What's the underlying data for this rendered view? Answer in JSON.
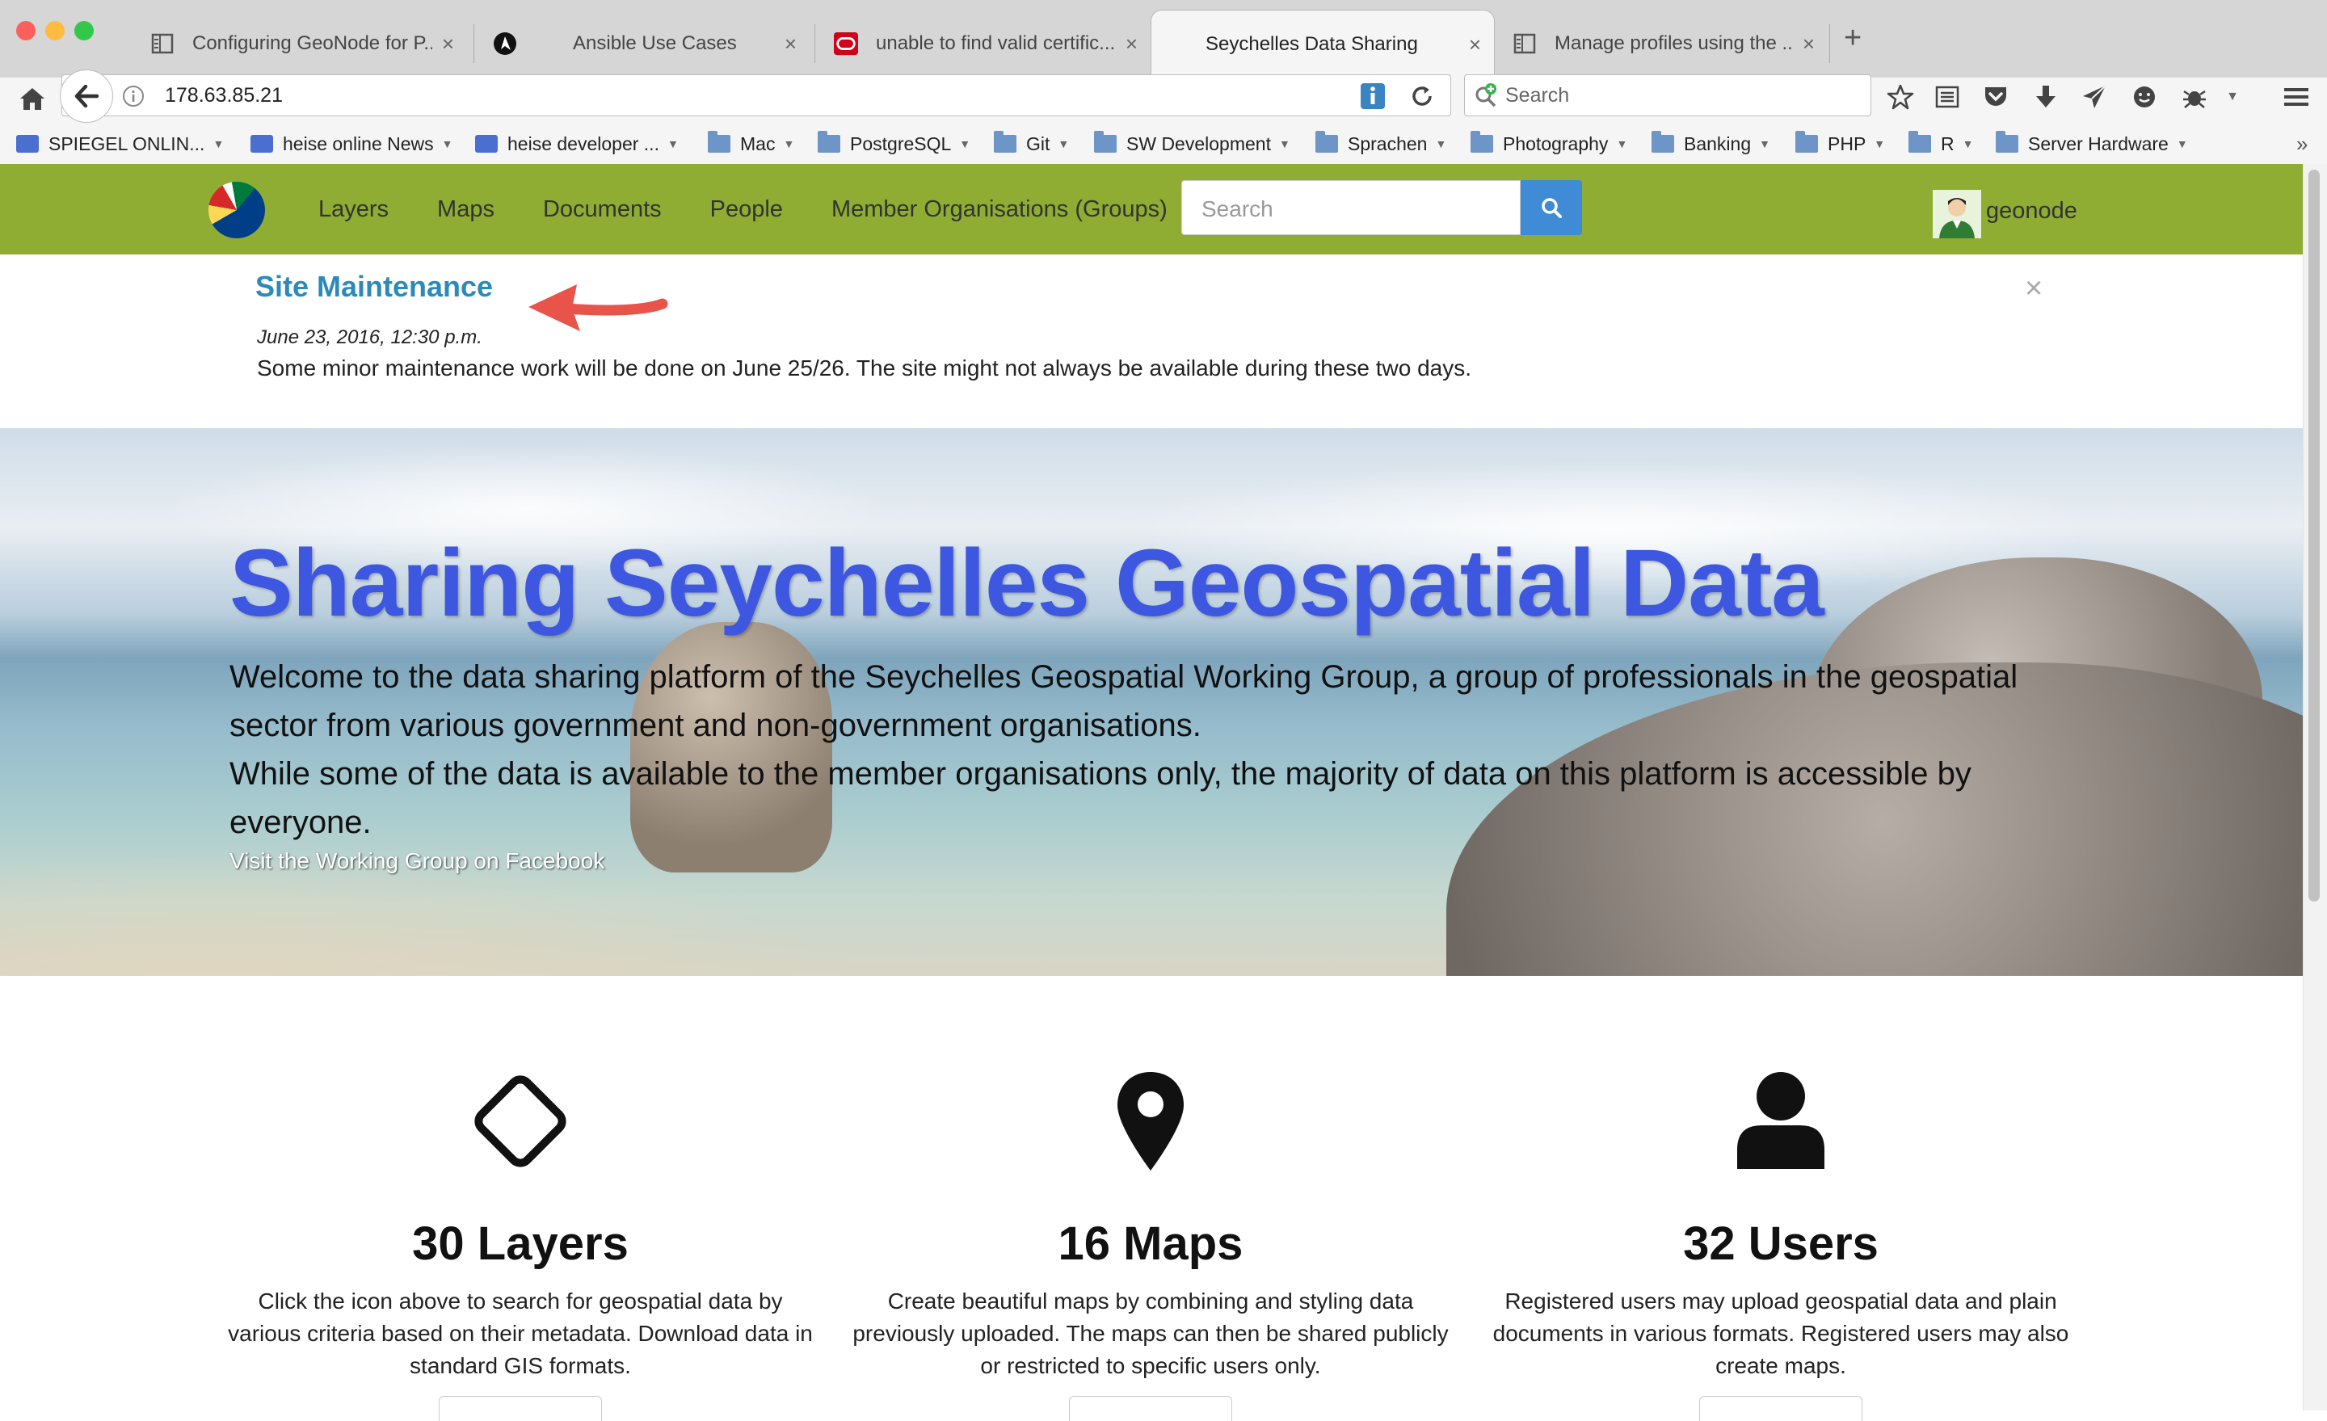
{
  "browser": {
    "tabs": [
      {
        "title": "Configuring GeoNode for P...",
        "icon": "reader-icon"
      },
      {
        "title": "Ansible Use Cases",
        "icon": "ansible-icon"
      },
      {
        "title": "unable to find valid certific...",
        "icon": "oracle-icon"
      },
      {
        "title": "Seychelles Data Sharing",
        "icon": "none",
        "active": true
      },
      {
        "title": "Manage profiles using the ...",
        "icon": "reader-icon"
      }
    ],
    "url": "178.63.85.21",
    "search_placeholder": "Search",
    "bookmarks": [
      {
        "label": "SPIEGEL ONLIN...",
        "type": "feed"
      },
      {
        "label": "heise online News",
        "type": "feed"
      },
      {
        "label": "heise developer ...",
        "type": "feed"
      },
      {
        "label": "Mac",
        "type": "folder"
      },
      {
        "label": "PostgreSQL",
        "type": "folder"
      },
      {
        "label": "Git",
        "type": "folder"
      },
      {
        "label": "SW Development",
        "type": "folder"
      },
      {
        "label": "Sprachen",
        "type": "folder"
      },
      {
        "label": "Photography",
        "type": "folder"
      },
      {
        "label": "Banking",
        "type": "folder"
      },
      {
        "label": "PHP",
        "type": "folder"
      },
      {
        "label": "R",
        "type": "folder"
      },
      {
        "label": "Server Hardware",
        "type": "folder"
      }
    ]
  },
  "site": {
    "nav": [
      "Layers",
      "Maps",
      "Documents",
      "People",
      "Member Organisations (Groups)"
    ],
    "search_placeholder": "Search",
    "username": "geonode",
    "accent": "#8fac33"
  },
  "announcement": {
    "title": "Site Maintenance",
    "date": "June 23, 2016, 12:30 p.m.",
    "body": "Some minor maintenance work will be done on June 25/26. The site might not always be available during these two days.",
    "close": "×"
  },
  "hero": {
    "title": "Sharing Seychelles Geospatial Data",
    "text1": "Welcome to the data sharing platform of the Seychelles Geospatial Working Group, a group of professionals in the geospatial sector from various government and non-government organisations.",
    "text2": "While some of the data is available to the member organisations only, the majority of data on this platform is accessible by everyone.",
    "link": "Visit the Working Group on Facebook"
  },
  "stats": [
    {
      "count": "30 Layers",
      "icon": "diamond-icon",
      "desc": "Click the icon above to search for geospatial data by various criteria based on their metadata. Download data in standard GIS formats."
    },
    {
      "count": "16 Maps",
      "icon": "map-marker-icon",
      "desc": "Create beautiful maps by combining and styling data previously uploaded. The maps can then be shared publicly or restricted to specific users only."
    },
    {
      "count": "32 Users",
      "icon": "user-icon",
      "desc": "Registered users may upload geospatial data and plain documents in various formats. Registered users may also create maps."
    }
  ]
}
